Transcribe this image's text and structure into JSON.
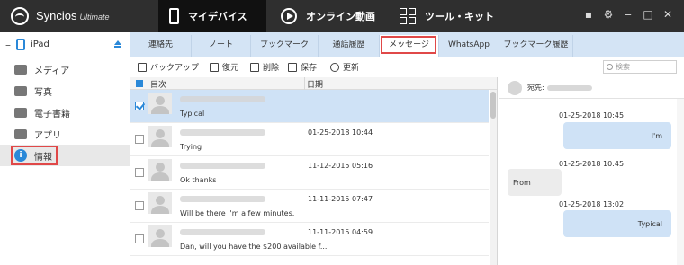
{
  "app": {
    "name": "Syncios",
    "edition": "Ultimate",
    "nav_tabs": [
      {
        "label": "マイデバイス",
        "icon": "phone-icon"
      },
      {
        "label": "オンライン動画",
        "icon": "play-icon"
      },
      {
        "label": "ツール・キット",
        "icon": "toolkit-icon"
      }
    ],
    "window_buttons": [
      "chat-icon",
      "settings-icon",
      "minimize-icon",
      "maximize-icon",
      "close-icon"
    ]
  },
  "sidebar": {
    "device_name": "iPad",
    "items": [
      {
        "label": "メディア",
        "icon": "media-icon"
      },
      {
        "label": "写真",
        "icon": "photo-icon"
      },
      {
        "label": "電子書籍",
        "icon": "ebook-icon"
      },
      {
        "label": "アプリ",
        "icon": "apps-icon"
      },
      {
        "label": "情報",
        "icon": "info-icon"
      }
    ],
    "selected": "情報"
  },
  "content_tabs": [
    "連絡先",
    "ノート",
    "ブックマーク",
    "通話履歴",
    "メッセージ",
    "WhatsApp",
    "ブックマーク履歴"
  ],
  "active_tab": "メッセージ",
  "toolbar": {
    "backup": "バックアップ",
    "restore": "復元",
    "delete": "削除",
    "save": "保存",
    "refresh": "更新",
    "search_placeholder": "検索"
  },
  "list": {
    "col_contents": "目次",
    "col_date": "日期",
    "rows": [
      {
        "snippet": "Typical",
        "date": "",
        "selected": true
      },
      {
        "snippet": "Trying",
        "date": "01-25-2018 10:44",
        "selected": false
      },
      {
        "snippet": "Ok thanks",
        "date": "11-12-2015 05:16",
        "selected": false
      },
      {
        "snippet": "Will be there I'm a few minutes.",
        "date": "11-11-2015 07:47",
        "selected": false
      },
      {
        "snippet": "Dan, will you have the $200 available f...",
        "date": "11-11-2015 04:59",
        "selected": false
      }
    ]
  },
  "conversation": {
    "to_label": "宛先:",
    "messages": [
      {
        "time": "01-25-2018 10:45",
        "text": "I'm",
        "direction": "out"
      },
      {
        "time": "01-25-2018 10:45",
        "text": "From",
        "direction": "in"
      },
      {
        "time": "01-25-2018 13:02",
        "text": "Typical",
        "direction": "out"
      }
    ]
  }
}
